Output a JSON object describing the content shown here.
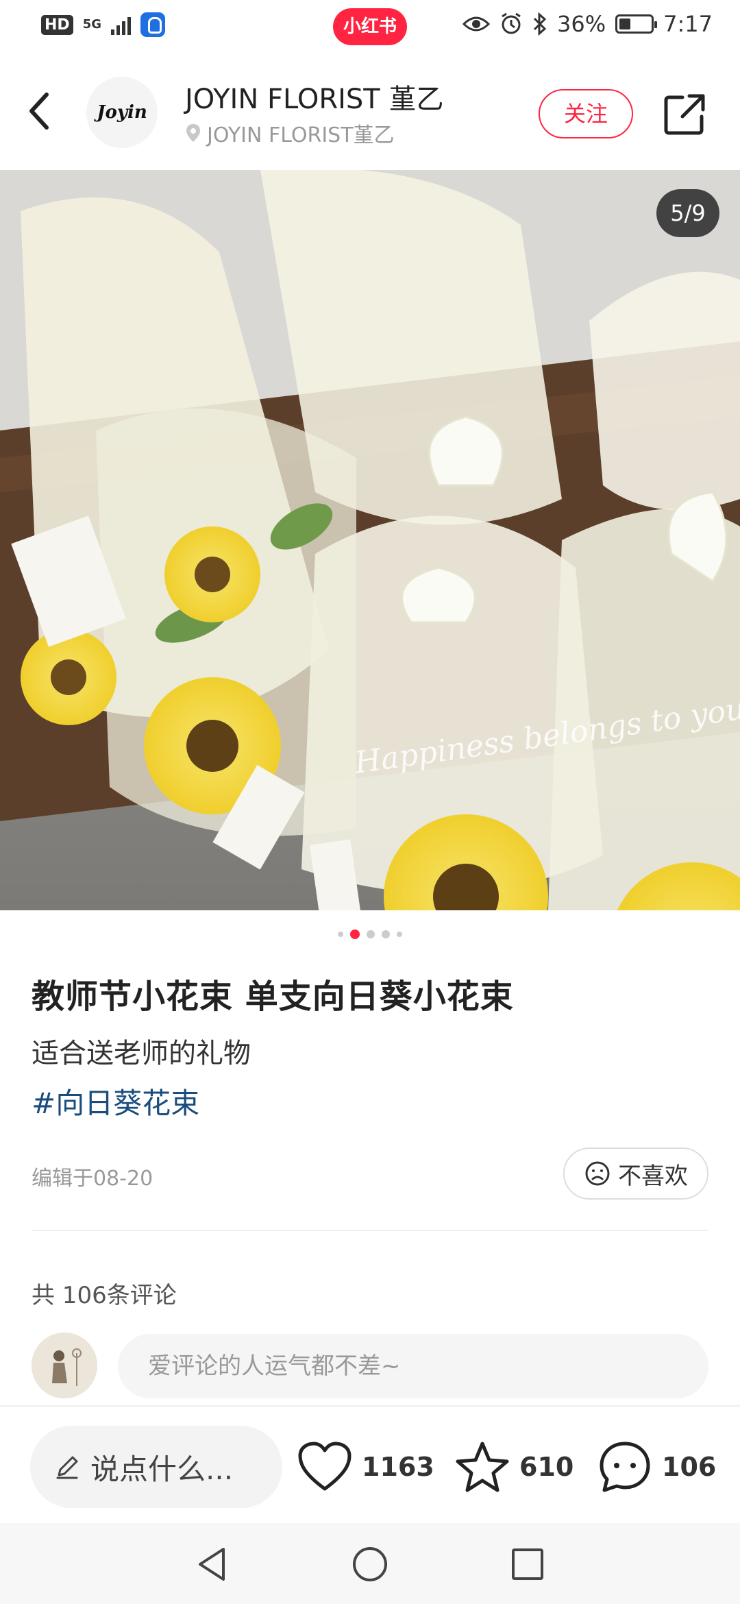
{
  "status_bar": {
    "hd": "HD",
    "network": "5G",
    "center_app": "小红书",
    "battery": "36%",
    "time": "7:17"
  },
  "header": {
    "avatar_text": "Joyin",
    "author_name": "JOYIN FLORIST 堇乙",
    "author_location": "JOYIN FLORIST堇乙",
    "follow_label": "关注"
  },
  "image": {
    "page_indicator": "5/9",
    "card_text": "Happiness belongs to you"
  },
  "post": {
    "title": "教师节小花束 单支向日葵小花束",
    "description": "适合送老师的礼物",
    "hashtag": "#向日葵花束",
    "edit_time": "编辑于08-20",
    "dislike_label": "不喜欢"
  },
  "comments": {
    "count_label": "共 106条评论",
    "input_placeholder": "爱评论的人运气都不差~"
  },
  "action_bar": {
    "say_label": "说点什么...",
    "likes": "1163",
    "collects": "610",
    "comments": "106"
  },
  "colors": {
    "brand": "#ff2442",
    "hashtag": "#1a4d7e"
  }
}
